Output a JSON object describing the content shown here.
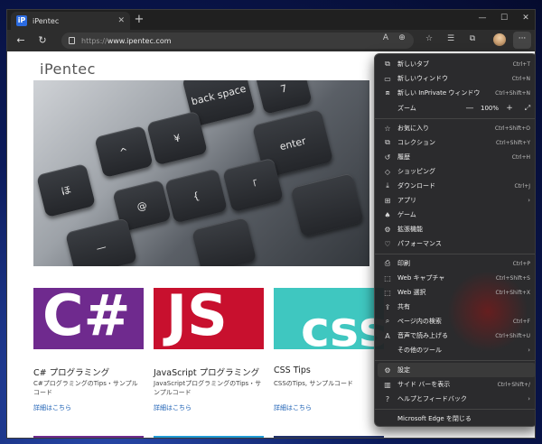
{
  "tab": {
    "title": "iPentec",
    "favicon": "iP"
  },
  "address": {
    "protocol": "https://",
    "host": "www.ipentec.com"
  },
  "site": {
    "logo": "iPentec"
  },
  "hero_keys": [
    {
      "label": "back space",
      "icon": "arrow-left"
    },
    {
      "label": "enter",
      "icon": "arrow-return"
    },
    {
      "label": "7"
    },
    {
      "label": "¥"
    },
    {
      "label": "^"
    },
    {
      "label": "{"
    },
    {
      "label": "「"
    },
    {
      "label": "@"
    },
    {
      "label": "ほ"
    },
    {
      "label": "—"
    }
  ],
  "cards": [
    {
      "title": "C# プログラミング",
      "desc": "C#プログラミングのTips・サンプルコード",
      "link": "詳細はこちら",
      "thumb_text": "C#",
      "color": "#6f2a8e"
    },
    {
      "title": "JavaScript プログラミング",
      "desc": "JavaScriptプログラミングのTips・サンプルコード",
      "link": "詳細はこちら",
      "thumb_text": "JS",
      "color": "#c8102e"
    },
    {
      "title": "CSS Tips",
      "desc": "CSSのTips, サンプルコード",
      "link": "詳細はこちら",
      "thumb_text": "css",
      "color": "#3fc7c0"
    }
  ],
  "menu": {
    "items": [
      {
        "icon": "new-tab-icon",
        "glyph": "⧉",
        "label": "新しいタブ",
        "shortcut": "Ctrl+T"
      },
      {
        "icon": "new-window-icon",
        "glyph": "▭",
        "label": "新しいウィンドウ",
        "shortcut": "Ctrl+N"
      },
      {
        "icon": "inprivate-icon",
        "glyph": "⧈",
        "label": "新しい InPrivate ウィンドウ",
        "shortcut": "Ctrl+Shift+N"
      }
    ],
    "zoom": {
      "label": "ズーム",
      "minus": "—",
      "value": "100%",
      "plus": "+",
      "fullscreen": "⤢"
    },
    "items2": [
      {
        "icon": "favorites-icon",
        "glyph": "☆",
        "label": "お気に入り",
        "shortcut": "Ctrl+Shift+O"
      },
      {
        "icon": "collections-icon",
        "glyph": "⧉",
        "label": "コレクション",
        "shortcut": "Ctrl+Shift+Y"
      },
      {
        "icon": "history-icon",
        "glyph": "↺",
        "label": "履歴",
        "shortcut": "Ctrl+H"
      },
      {
        "icon": "shopping-icon",
        "glyph": "◇",
        "label": "ショッピング",
        "shortcut": ""
      },
      {
        "icon": "download-icon",
        "glyph": "⤓",
        "label": "ダウンロード",
        "shortcut": "Ctrl+J"
      },
      {
        "icon": "apps-icon",
        "glyph": "⊞",
        "label": "アプリ",
        "shortcut": "",
        "submenu": true
      },
      {
        "icon": "games-icon",
        "glyph": "♠",
        "label": "ゲーム",
        "shortcut": ""
      },
      {
        "icon": "extensions-icon",
        "glyph": "⚙",
        "label": "拡張機能",
        "shortcut": ""
      },
      {
        "icon": "performance-icon",
        "glyph": "♡",
        "label": "パフォーマンス",
        "shortcut": ""
      }
    ],
    "items3": [
      {
        "icon": "print-icon",
        "glyph": "⎙",
        "label": "印刷",
        "shortcut": "Ctrl+P"
      },
      {
        "icon": "web-capture-icon",
        "glyph": "⬚",
        "label": "Web キャプチャ",
        "shortcut": "Ctrl+Shift+S"
      },
      {
        "icon": "web-select-icon",
        "glyph": "⬚",
        "label": "Web 選択",
        "shortcut": "Ctrl+Shift+X"
      },
      {
        "icon": "share-icon",
        "glyph": "⇪",
        "label": "共有",
        "shortcut": ""
      },
      {
        "icon": "find-on-page-icon",
        "glyph": "⌕",
        "label": "ページ内の検索",
        "shortcut": "Ctrl+F"
      },
      {
        "icon": "read-aloud-icon",
        "glyph": "A",
        "label": "音声で読み上げる",
        "shortcut": "Ctrl+Shift+U"
      },
      {
        "icon": "more-tools-icon",
        "glyph": "",
        "label": "その他のツール",
        "shortcut": "",
        "submenu": true
      }
    ],
    "items4": [
      {
        "icon": "settings-icon",
        "glyph": "⚙",
        "label": "設定",
        "shortcut": ""
      },
      {
        "icon": "sidebar-icon",
        "glyph": "▥",
        "label": "サイド バーを表示",
        "shortcut": "Ctrl+Shift+/"
      },
      {
        "icon": "help-icon",
        "glyph": "?",
        "label": "ヘルプとフィードバック",
        "shortcut": "",
        "submenu": true
      }
    ],
    "close_label": "Microsoft Edge を閉じる"
  }
}
